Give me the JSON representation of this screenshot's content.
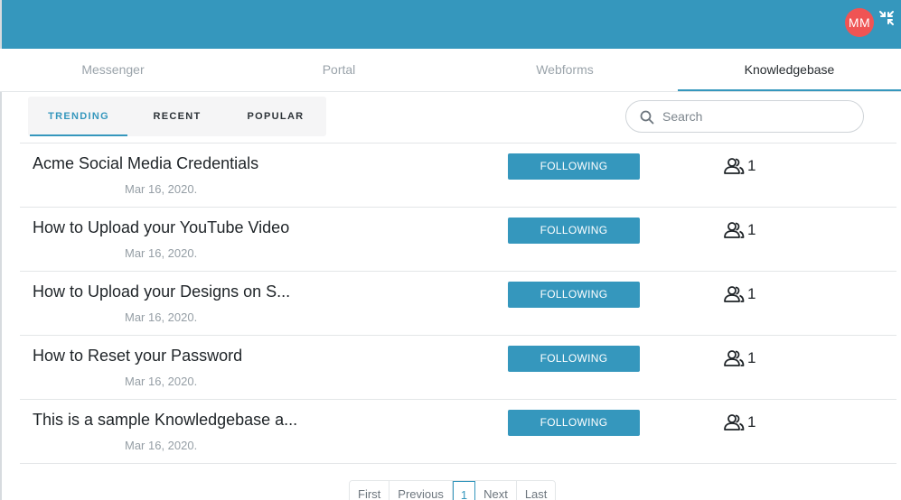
{
  "header": {
    "avatar_initials": "MM",
    "collapse_icon": "collapse-arrows-icon",
    "background": "#3597bd",
    "avatar_color": "#ef5454"
  },
  "tabs": [
    {
      "label": "Messenger",
      "active": false
    },
    {
      "label": "Portal",
      "active": false
    },
    {
      "label": "Webforms",
      "active": false
    },
    {
      "label": "Knowledgebase",
      "active": true
    }
  ],
  "subtabs": [
    {
      "label": "TRENDING",
      "active": true
    },
    {
      "label": "RECENT",
      "active": false
    },
    {
      "label": "POPULAR",
      "active": false
    }
  ],
  "search": {
    "placeholder": "Search",
    "value": ""
  },
  "articles": [
    {
      "title": "Acme Social Media Credentials",
      "date": "Mar 16, 2020.",
      "button": "FOLLOWING",
      "followers": "1"
    },
    {
      "title": "How to Upload your YouTube Video",
      "date": "Mar 16, 2020.",
      "button": "FOLLOWING",
      "followers": "1"
    },
    {
      "title": "How to Upload your Designs on S...",
      "date": "Mar 16, 2020.",
      "button": "FOLLOWING",
      "followers": "1"
    },
    {
      "title": "How to Reset your Password",
      "date": "Mar 16, 2020.",
      "button": "FOLLOWING",
      "followers": "1"
    },
    {
      "title": "This is a sample Knowledgebase a...",
      "date": "Mar 16, 2020.",
      "button": "FOLLOWING",
      "followers": "1"
    }
  ],
  "pagination": {
    "first": "First",
    "previous": "Previous",
    "current": "1",
    "next": "Next",
    "last": "Last"
  },
  "colors": {
    "accent": "#3597bd",
    "text": "#1f2428",
    "muted": "#959ea5"
  }
}
